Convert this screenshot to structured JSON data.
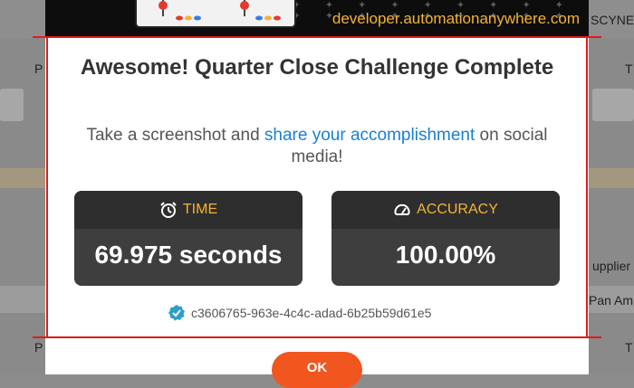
{
  "banner": {
    "url": "developer.automationanywhere.com"
  },
  "background": {
    "labels": {
      "right_top": "SCYNE",
      "left_p1": "P",
      "right_t1": "T",
      "right_supplier": "upplier",
      "right_panam": "Pan Am",
      "left_p2": "P",
      "right_t2": "T"
    }
  },
  "dialog": {
    "title": "Awesome! Quarter Close Challenge Complete",
    "subtitle_prefix": "Take a screenshot and ",
    "subtitle_link": "share your accomplishment",
    "subtitle_suffix": " on social media!",
    "time": {
      "label": "TIME",
      "value": "69.975 seconds"
    },
    "accuracy": {
      "label": "ACCURACY",
      "value": "100.00%"
    },
    "session_id": "c3606765-963e-4c4c-adad-6b25b59d61e5",
    "ok_label": "OK"
  },
  "colors": {
    "accent_orange": "#f0561e",
    "label_gold": "#f5b335",
    "link_blue": "#1a7fd4",
    "frame_red": "#e21b1b",
    "verified_teal": "#2e9fc7"
  },
  "icons": {
    "time": "alarm-clock-icon",
    "accuracy": "speedometer-icon",
    "verified": "verified-badge-icon"
  }
}
